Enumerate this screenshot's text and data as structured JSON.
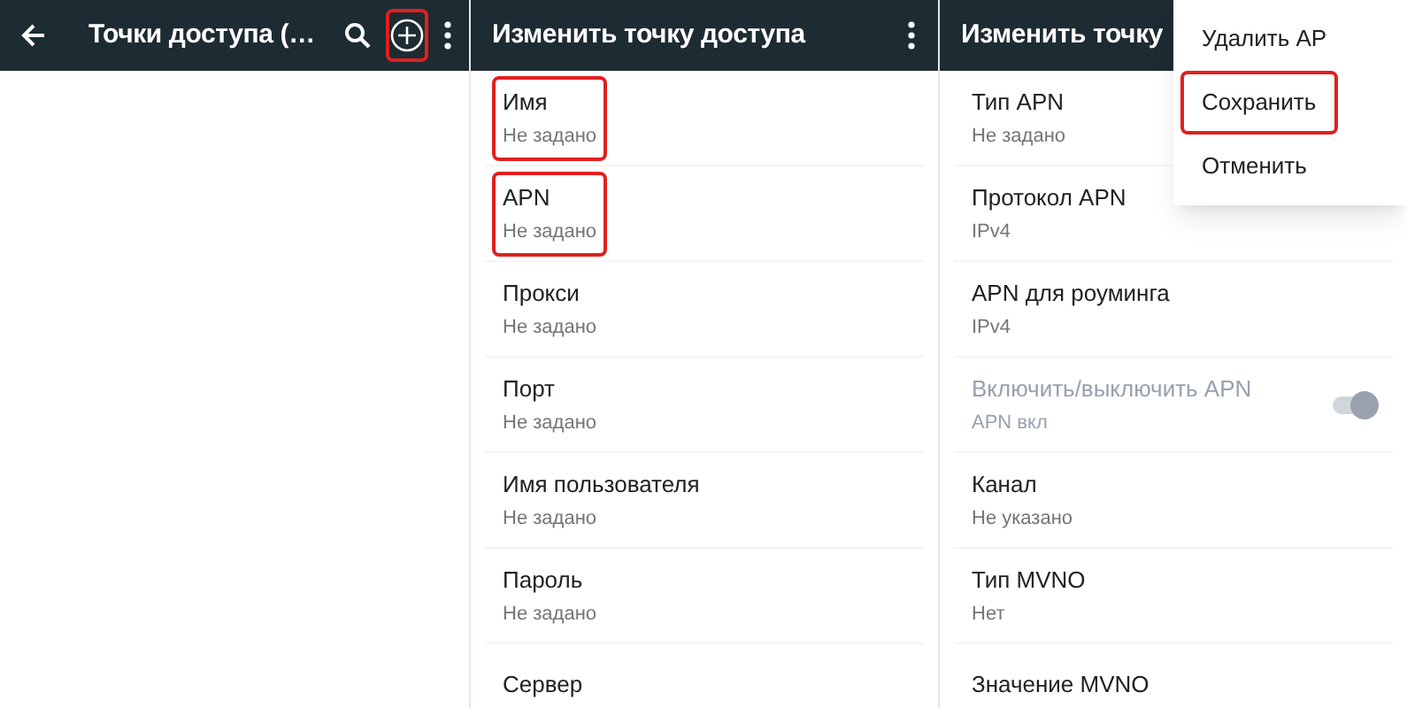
{
  "panes": [
    {
      "title": "Точки доступа (…",
      "actions": [
        {
          "kind": "search"
        },
        {
          "kind": "add",
          "highlighted": true
        },
        {
          "kind": "more"
        }
      ],
      "back": true
    },
    {
      "title": "Изменить точку доступа",
      "actions": [
        {
          "kind": "more"
        }
      ],
      "rows": [
        {
          "kind": "text",
          "title": "Имя",
          "value": "Не задано",
          "highlighted": true,
          "disabled": false
        },
        {
          "kind": "text",
          "title": "APN",
          "value": "Не задано",
          "highlighted": true,
          "disabled": false
        },
        {
          "kind": "text",
          "title": "Прокси",
          "value": "Не задано",
          "highlighted": false,
          "disabled": false
        },
        {
          "kind": "text",
          "title": "Порт",
          "value": "Не задано",
          "highlighted": false,
          "disabled": false
        },
        {
          "kind": "text",
          "title": "Имя пользователя",
          "value": "Не задано",
          "highlighted": false,
          "disabled": false
        },
        {
          "kind": "text",
          "title": "Пароль",
          "value": "Не задано",
          "highlighted": false,
          "disabled": false
        },
        {
          "kind": "text",
          "title": "Сервер",
          "highlighted": false,
          "disabled": false
        }
      ]
    },
    {
      "title": "Изменить точку",
      "rows": [
        {
          "kind": "text",
          "title": "Тип APN",
          "value": "Не задано",
          "highlighted": false,
          "disabled": false
        },
        {
          "kind": "text",
          "title": "Протокол APN",
          "value": "IPv4",
          "highlighted": false,
          "disabled": false
        },
        {
          "kind": "text",
          "title": "APN для роуминга",
          "value": "IPv4",
          "highlighted": false,
          "disabled": false
        },
        {
          "kind": "toggle",
          "title": "Включить/выключить APN",
          "value": "APN вкл",
          "highlighted": false,
          "disabled": true,
          "on": true
        },
        {
          "kind": "text",
          "title": "Канал",
          "value": "Не указано",
          "highlighted": false,
          "disabled": false
        },
        {
          "kind": "text",
          "title": "Тип MVNO",
          "value": "Нет",
          "highlighted": false,
          "disabled": false
        },
        {
          "kind": "text",
          "title": "Значение MVNO",
          "highlighted": false,
          "disabled": false
        }
      ]
    }
  ],
  "menu": {
    "items": [
      {
        "label": "Удалить AP",
        "highlighted": false
      },
      {
        "label": "Сохранить",
        "highlighted": true
      },
      {
        "label": "Отменить",
        "highlighted": false
      }
    ]
  }
}
